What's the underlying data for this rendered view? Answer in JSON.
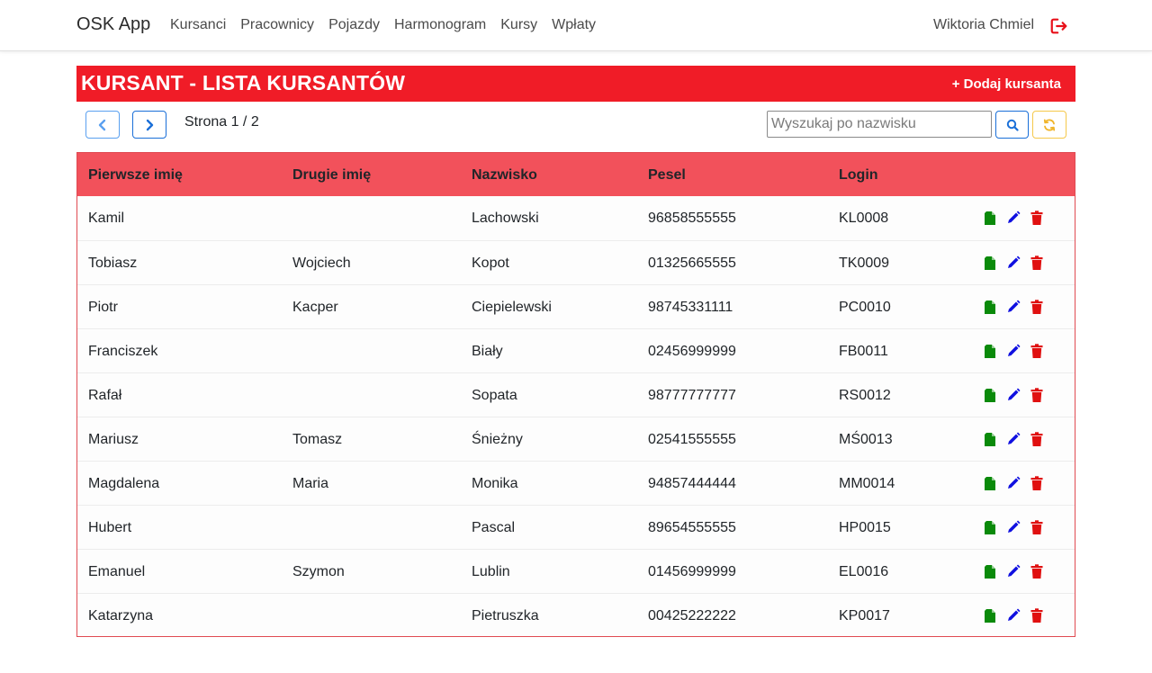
{
  "nav": {
    "brand": "OSK App",
    "links": [
      "Kursanci",
      "Pracownicy",
      "Pojazdy",
      "Harmonogram",
      "Kursy",
      "Wpłaty"
    ],
    "user": "Wiktoria Chmiel",
    "logout_icon": "sign-out-icon"
  },
  "header": {
    "title": "KURSANT - LISTA KURSANTÓW",
    "add_label": "+ Dodaj kursanta"
  },
  "pagination": {
    "page_text": "Strona 1 / 2",
    "current": 1,
    "total": 2
  },
  "search": {
    "placeholder": "Wyszukaj po nazwisku",
    "value": ""
  },
  "table": {
    "columns": [
      "Pierwsze imię",
      "Drugie imię",
      "Nazwisko",
      "Pesel",
      "Login"
    ],
    "rows": [
      [
        "Kamil",
        "",
        "Lachowski",
        "96858555555",
        "KL0008"
      ],
      [
        "Tobiasz",
        "Wojciech",
        "Kopot",
        "01325665555",
        "TK0009"
      ],
      [
        "Piotr",
        "Kacper",
        "Ciepielewski",
        "98745331111",
        "PC0010"
      ],
      [
        "Franciszek",
        "",
        "Biały",
        "02456999999",
        "FB0011"
      ],
      [
        "Rafał",
        "",
        "Sopata",
        "98777777777",
        "RS0012"
      ],
      [
        "Mariusz",
        "Tomasz",
        "Śnieżny",
        "02541555555",
        "MŚ0013"
      ],
      [
        "Magdalena",
        "Maria",
        "Monika",
        "94857444444",
        "MM0014"
      ],
      [
        "Hubert",
        "",
        "Pascal",
        "89654555555",
        "HP0015"
      ],
      [
        "Emanuel",
        "Szymon",
        "Lublin",
        "01456999999",
        "EL0016"
      ],
      [
        "Katarzyna",
        "",
        "Pietruszka",
        "00425222222",
        "KP0017"
      ]
    ],
    "row_actions": [
      "file-icon",
      "pencil-icon",
      "trash-icon"
    ]
  },
  "colors": {
    "accent": "#f01c27",
    "table_header": "#f2515b",
    "action_file": "#0a8a0a",
    "action_edit": "#1010e0",
    "action_delete": "#e01010"
  }
}
